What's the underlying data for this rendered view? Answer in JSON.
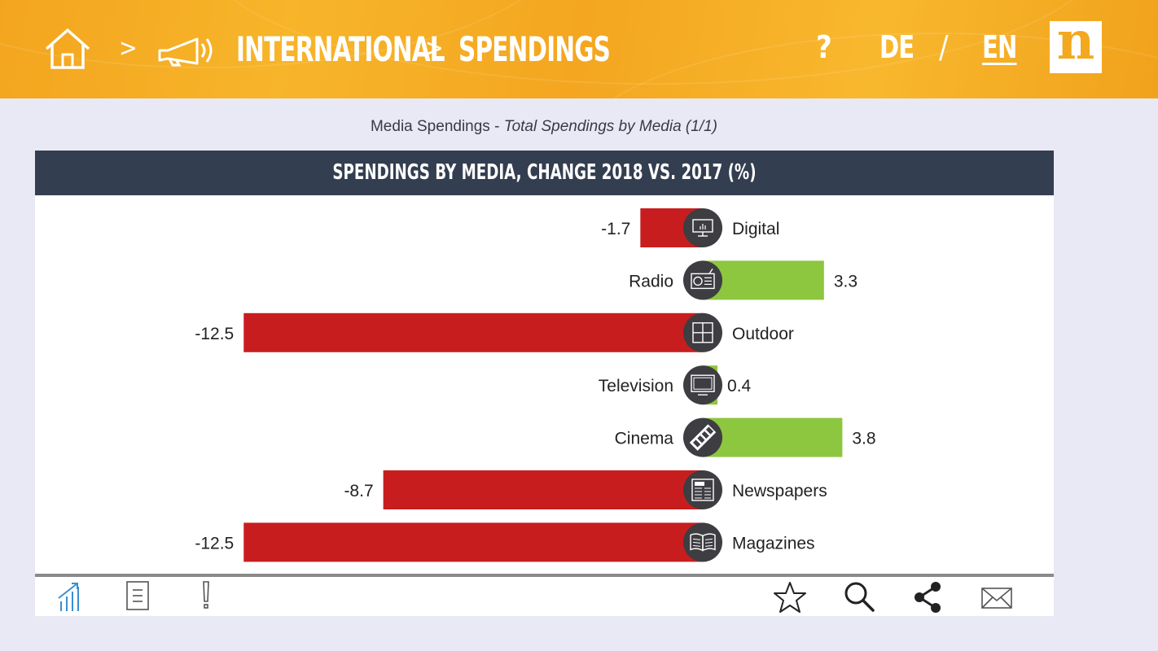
{
  "header": {
    "breadcrumb_separator_1": ">",
    "breadcrumb_1": "INTERNATIONAL",
    "breadcrumb_separator_2": ">",
    "breadcrumb_2": "SPENDINGS",
    "help": "?",
    "lang_de": "DE",
    "lang_slash": "/",
    "lang_en": "EN",
    "logo_letter": "n",
    "icons": [
      "home-icon",
      "megaphone-icon"
    ]
  },
  "subtitle": {
    "main": "Media Spendings - ",
    "italic": "Total Spendings by Media (1/1)"
  },
  "card": {
    "title": "SPENDINGS BY MEDIA, CHANGE 2018 VS. 2017 (%)"
  },
  "colors": {
    "negative": "#c81d1f",
    "positive": "#8dc63f",
    "icon_circle": "#3d3d42",
    "title_bar": "#333e50",
    "header_orange": "#f4a620"
  },
  "chart_data": {
    "type": "bar",
    "orientation": "horizontal-diverging",
    "title": "SPENDINGS BY MEDIA, CHANGE 2018 VS. 2017 (%)",
    "categories": [
      "Digital",
      "Radio",
      "Outdoor",
      "Television",
      "Cinema",
      "Newspapers",
      "Magazines"
    ],
    "values": [
      -1.7,
      3.3,
      -12.5,
      0.4,
      3.8,
      -8.7,
      -12.5
    ],
    "value_labels": [
      "-1.7",
      "3.3",
      "-12.5",
      "0.4",
      "3.8",
      "-8.7",
      "-12.5"
    ],
    "icons": [
      "monitor-icon",
      "radio-icon",
      "billboard-icon",
      "television-icon",
      "film-icon",
      "newspaper-icon",
      "magazine-icon"
    ],
    "xlim": [
      -12.5,
      4
    ],
    "grid": false,
    "legend": "none"
  },
  "footer": {
    "left_icons": [
      "chart-icon",
      "document-icon",
      "exclamation-icon"
    ],
    "right_icons": [
      "star-icon",
      "search-icon",
      "share-icon",
      "mail-icon"
    ],
    "active_color": "#3a8fd1"
  }
}
